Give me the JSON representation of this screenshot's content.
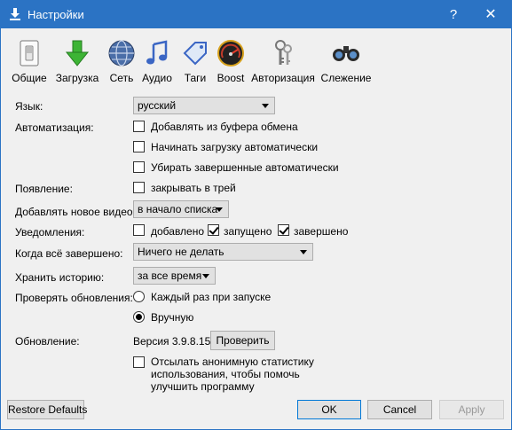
{
  "window": {
    "title": "Настройки",
    "help_symbol": "?",
    "close_symbol": "✕"
  },
  "toolbar": {
    "items": [
      {
        "label": "Общие",
        "icon": "switch-icon"
      },
      {
        "label": "Загрузка",
        "icon": "download-arrow-icon"
      },
      {
        "label": "Сеть",
        "icon": "globe-icon"
      },
      {
        "label": "Аудио",
        "icon": "music-note-icon"
      },
      {
        "label": "Таги",
        "icon": "tag-icon"
      },
      {
        "label": "Boost",
        "icon": "speedometer-icon"
      },
      {
        "label": "Авторизация",
        "icon": "keys-icon"
      },
      {
        "label": "Слежение",
        "icon": "binoculars-icon"
      }
    ]
  },
  "form": {
    "language": {
      "label": "Язык:",
      "value": "русский"
    },
    "automation": {
      "label": "Автоматизация:",
      "options": [
        {
          "text": "Добавлять из буфера обмена",
          "checked": false
        },
        {
          "text": "Начинать загрузку автоматически",
          "checked": false
        },
        {
          "text": "Убирать завершенные автоматически",
          "checked": false
        }
      ]
    },
    "appearance": {
      "label": "Появление:",
      "option": {
        "text": "закрывать в трей",
        "checked": false
      }
    },
    "add_video": {
      "label": "Добавлять новое видео:",
      "value": "в начало списка"
    },
    "notifications": {
      "label": "Уведомления:",
      "options": [
        {
          "text": "добавлено",
          "checked": false
        },
        {
          "text": "запущено",
          "checked": true
        },
        {
          "text": "завершено",
          "checked": true
        }
      ]
    },
    "when_done": {
      "label": "Когда всё завершено:",
      "value": "Ничего не делать"
    },
    "history": {
      "label": "Хранить историю:",
      "value": "за все время"
    },
    "check_updates": {
      "label": "Проверять обновления:",
      "options": [
        {
          "text": "Каждый раз при запуске",
          "selected": false
        },
        {
          "text": "Вручную",
          "selected": true
        }
      ]
    },
    "update": {
      "label": "Обновление:",
      "version_text": "Версия 3.9.8.15",
      "check_button": "Проверить"
    },
    "stats": {
      "checked": false,
      "lines": [
        "Отсылать анонимную статистику",
        "использования, чтобы помочь",
        "улучшить программу"
      ]
    }
  },
  "footer": {
    "restore": "Restore Defaults",
    "ok": "OK",
    "cancel": "Cancel",
    "apply": "Apply"
  },
  "colors": {
    "titlebar": "#2b73c4",
    "background": "#f0f0f0",
    "default_button_border": "#0078d7"
  }
}
